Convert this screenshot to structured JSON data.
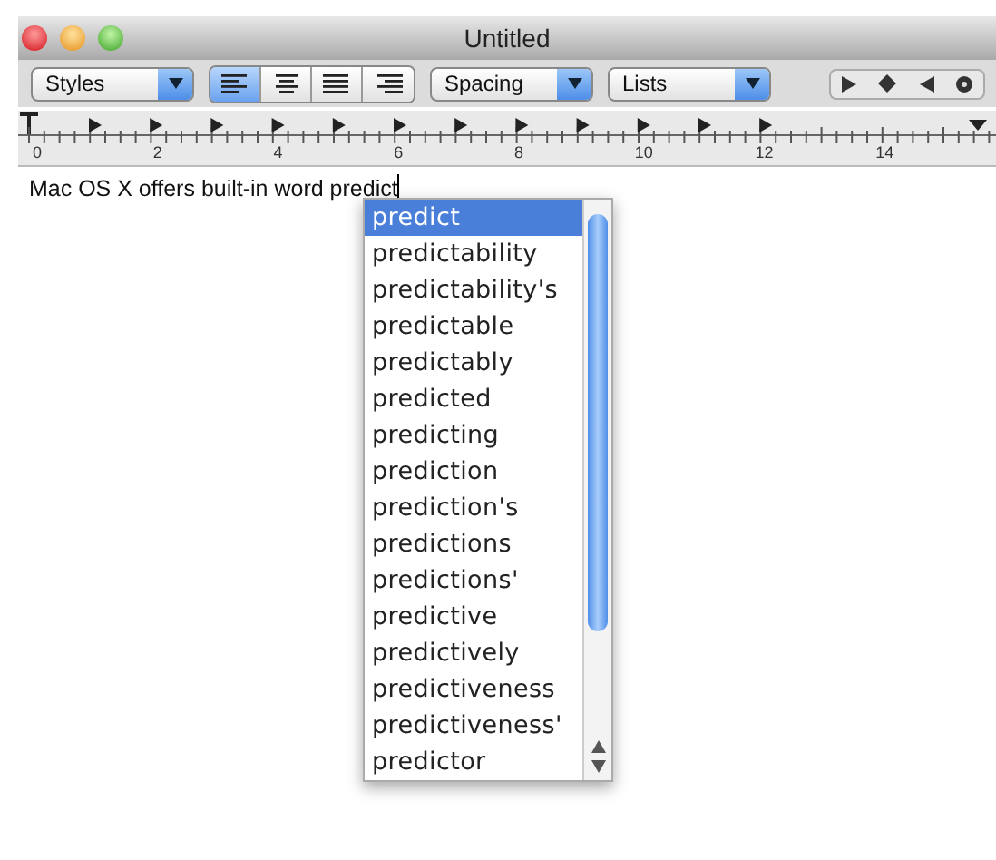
{
  "window": {
    "title": "Untitled"
  },
  "toolbar": {
    "styles": "Styles",
    "alignment": [
      {
        "kind": "left",
        "selected": true
      },
      {
        "kind": "center",
        "selected": false
      },
      {
        "kind": "justify",
        "selected": false
      },
      {
        "kind": "right",
        "selected": false
      }
    ],
    "spacing": "Spacing",
    "lists": "Lists"
  },
  "ruler": {
    "labels": [
      "0",
      "2",
      "4",
      "6",
      "8",
      "10",
      "12",
      "14"
    ]
  },
  "document": {
    "text": "Mac OS X offers built-in word predict"
  },
  "completions": [
    {
      "word": "predict",
      "selected": true
    },
    {
      "word": "predictability",
      "selected": false
    },
    {
      "word": "predictability's",
      "selected": false
    },
    {
      "word": "predictable",
      "selected": false
    },
    {
      "word": "predictably",
      "selected": false
    },
    {
      "word": "predicted",
      "selected": false
    },
    {
      "word": "predicting",
      "selected": false
    },
    {
      "word": "prediction",
      "selected": false
    },
    {
      "word": "prediction's",
      "selected": false
    },
    {
      "word": "predictions",
      "selected": false
    },
    {
      "word": "predictions'",
      "selected": false
    },
    {
      "word": "predictive",
      "selected": false
    },
    {
      "word": "predictively",
      "selected": false
    },
    {
      "word": "predictiveness",
      "selected": false
    },
    {
      "word": "predictiveness'",
      "selected": false
    },
    {
      "word": "predictor",
      "selected": false
    }
  ]
}
